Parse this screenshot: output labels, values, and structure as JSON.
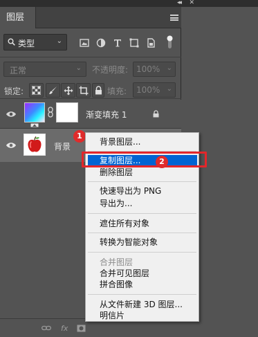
{
  "panel": {
    "tab_label": "图层"
  },
  "filter": {
    "kind_label": "类型",
    "icons": [
      "image-filter-icon",
      "adjustment-filter-icon",
      "type-filter-icon",
      "shape-filter-icon",
      "smart-object-filter-icon"
    ]
  },
  "blend": {
    "mode": "正常",
    "opacity_label": "不透明度:",
    "opacity_value": "100%"
  },
  "lock": {
    "label": "锁定:",
    "fill_label": "填充:",
    "fill_value": "100%"
  },
  "layers": [
    {
      "name": "渐变填充 1",
      "locked": true
    },
    {
      "name": "背景",
      "locked": true
    }
  ],
  "badges": {
    "first": "1",
    "second": "2"
  },
  "context_menu": {
    "items": [
      {
        "label": "背景图层..."
      },
      {
        "label": "复制图层..."
      },
      {
        "label": "删除图层"
      },
      {
        "label": "快速导出为 PNG"
      },
      {
        "label": "导出为..."
      },
      {
        "label": "遮住所有对象"
      },
      {
        "label": "转换为智能对象"
      },
      {
        "label": "合并图层"
      },
      {
        "label": "合并可见图层"
      },
      {
        "label": "拼合图像"
      },
      {
        "label": "从文件新建 3D 图层..."
      },
      {
        "label": "明信片"
      }
    ]
  },
  "bottom": {
    "link_label": "link-icon",
    "fx_label": "fx"
  },
  "colors": {
    "panel_bg": "#535353",
    "selected_layer_bg": "#6b6b6b",
    "menu_highlight": "#0064d2",
    "annotation_red": "#e3262a"
  }
}
